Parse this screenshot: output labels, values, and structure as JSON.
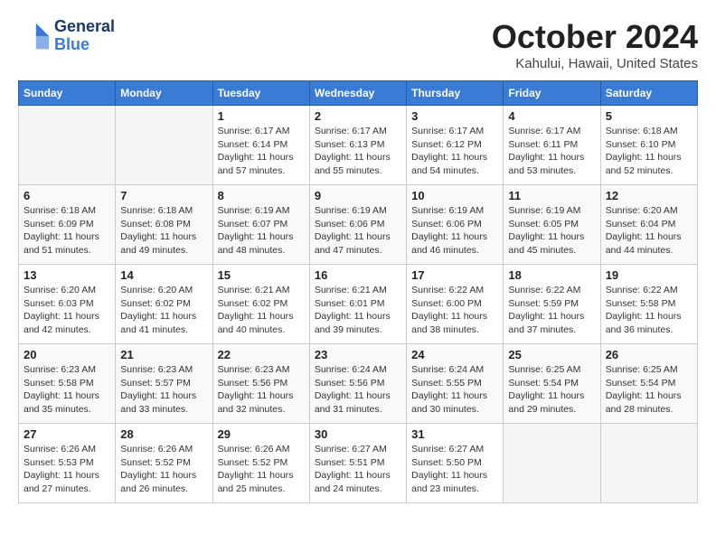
{
  "header": {
    "logo_line1": "General",
    "logo_line2": "Blue",
    "month": "October 2024",
    "location": "Kahului, Hawaii, United States"
  },
  "days_of_week": [
    "Sunday",
    "Monday",
    "Tuesday",
    "Wednesday",
    "Thursday",
    "Friday",
    "Saturday"
  ],
  "weeks": [
    [
      {
        "day": "",
        "sunrise": "",
        "sunset": "",
        "daylight": ""
      },
      {
        "day": "",
        "sunrise": "",
        "sunset": "",
        "daylight": ""
      },
      {
        "day": "1",
        "sunrise": "Sunrise: 6:17 AM",
        "sunset": "Sunset: 6:14 PM",
        "daylight": "Daylight: 11 hours and 57 minutes."
      },
      {
        "day": "2",
        "sunrise": "Sunrise: 6:17 AM",
        "sunset": "Sunset: 6:13 PM",
        "daylight": "Daylight: 11 hours and 55 minutes."
      },
      {
        "day": "3",
        "sunrise": "Sunrise: 6:17 AM",
        "sunset": "Sunset: 6:12 PM",
        "daylight": "Daylight: 11 hours and 54 minutes."
      },
      {
        "day": "4",
        "sunrise": "Sunrise: 6:17 AM",
        "sunset": "Sunset: 6:11 PM",
        "daylight": "Daylight: 11 hours and 53 minutes."
      },
      {
        "day": "5",
        "sunrise": "Sunrise: 6:18 AM",
        "sunset": "Sunset: 6:10 PM",
        "daylight": "Daylight: 11 hours and 52 minutes."
      }
    ],
    [
      {
        "day": "6",
        "sunrise": "Sunrise: 6:18 AM",
        "sunset": "Sunset: 6:09 PM",
        "daylight": "Daylight: 11 hours and 51 minutes."
      },
      {
        "day": "7",
        "sunrise": "Sunrise: 6:18 AM",
        "sunset": "Sunset: 6:08 PM",
        "daylight": "Daylight: 11 hours and 49 minutes."
      },
      {
        "day": "8",
        "sunrise": "Sunrise: 6:19 AM",
        "sunset": "Sunset: 6:07 PM",
        "daylight": "Daylight: 11 hours and 48 minutes."
      },
      {
        "day": "9",
        "sunrise": "Sunrise: 6:19 AM",
        "sunset": "Sunset: 6:06 PM",
        "daylight": "Daylight: 11 hours and 47 minutes."
      },
      {
        "day": "10",
        "sunrise": "Sunrise: 6:19 AM",
        "sunset": "Sunset: 6:06 PM",
        "daylight": "Daylight: 11 hours and 46 minutes."
      },
      {
        "day": "11",
        "sunrise": "Sunrise: 6:19 AM",
        "sunset": "Sunset: 6:05 PM",
        "daylight": "Daylight: 11 hours and 45 minutes."
      },
      {
        "day": "12",
        "sunrise": "Sunrise: 6:20 AM",
        "sunset": "Sunset: 6:04 PM",
        "daylight": "Daylight: 11 hours and 44 minutes."
      }
    ],
    [
      {
        "day": "13",
        "sunrise": "Sunrise: 6:20 AM",
        "sunset": "Sunset: 6:03 PM",
        "daylight": "Daylight: 11 hours and 42 minutes."
      },
      {
        "day": "14",
        "sunrise": "Sunrise: 6:20 AM",
        "sunset": "Sunset: 6:02 PM",
        "daylight": "Daylight: 11 hours and 41 minutes."
      },
      {
        "day": "15",
        "sunrise": "Sunrise: 6:21 AM",
        "sunset": "Sunset: 6:02 PM",
        "daylight": "Daylight: 11 hours and 40 minutes."
      },
      {
        "day": "16",
        "sunrise": "Sunrise: 6:21 AM",
        "sunset": "Sunset: 6:01 PM",
        "daylight": "Daylight: 11 hours and 39 minutes."
      },
      {
        "day": "17",
        "sunrise": "Sunrise: 6:22 AM",
        "sunset": "Sunset: 6:00 PM",
        "daylight": "Daylight: 11 hours and 38 minutes."
      },
      {
        "day": "18",
        "sunrise": "Sunrise: 6:22 AM",
        "sunset": "Sunset: 5:59 PM",
        "daylight": "Daylight: 11 hours and 37 minutes."
      },
      {
        "day": "19",
        "sunrise": "Sunrise: 6:22 AM",
        "sunset": "Sunset: 5:58 PM",
        "daylight": "Daylight: 11 hours and 36 minutes."
      }
    ],
    [
      {
        "day": "20",
        "sunrise": "Sunrise: 6:23 AM",
        "sunset": "Sunset: 5:58 PM",
        "daylight": "Daylight: 11 hours and 35 minutes."
      },
      {
        "day": "21",
        "sunrise": "Sunrise: 6:23 AM",
        "sunset": "Sunset: 5:57 PM",
        "daylight": "Daylight: 11 hours and 33 minutes."
      },
      {
        "day": "22",
        "sunrise": "Sunrise: 6:23 AM",
        "sunset": "Sunset: 5:56 PM",
        "daylight": "Daylight: 11 hours and 32 minutes."
      },
      {
        "day": "23",
        "sunrise": "Sunrise: 6:24 AM",
        "sunset": "Sunset: 5:56 PM",
        "daylight": "Daylight: 11 hours and 31 minutes."
      },
      {
        "day": "24",
        "sunrise": "Sunrise: 6:24 AM",
        "sunset": "Sunset: 5:55 PM",
        "daylight": "Daylight: 11 hours and 30 minutes."
      },
      {
        "day": "25",
        "sunrise": "Sunrise: 6:25 AM",
        "sunset": "Sunset: 5:54 PM",
        "daylight": "Daylight: 11 hours and 29 minutes."
      },
      {
        "day": "26",
        "sunrise": "Sunrise: 6:25 AM",
        "sunset": "Sunset: 5:54 PM",
        "daylight": "Daylight: 11 hours and 28 minutes."
      }
    ],
    [
      {
        "day": "27",
        "sunrise": "Sunrise: 6:26 AM",
        "sunset": "Sunset: 5:53 PM",
        "daylight": "Daylight: 11 hours and 27 minutes."
      },
      {
        "day": "28",
        "sunrise": "Sunrise: 6:26 AM",
        "sunset": "Sunset: 5:52 PM",
        "daylight": "Daylight: 11 hours and 26 minutes."
      },
      {
        "day": "29",
        "sunrise": "Sunrise: 6:26 AM",
        "sunset": "Sunset: 5:52 PM",
        "daylight": "Daylight: 11 hours and 25 minutes."
      },
      {
        "day": "30",
        "sunrise": "Sunrise: 6:27 AM",
        "sunset": "Sunset: 5:51 PM",
        "daylight": "Daylight: 11 hours and 24 minutes."
      },
      {
        "day": "31",
        "sunrise": "Sunrise: 6:27 AM",
        "sunset": "Sunset: 5:50 PM",
        "daylight": "Daylight: 11 hours and 23 minutes."
      },
      {
        "day": "",
        "sunrise": "",
        "sunset": "",
        "daylight": ""
      },
      {
        "day": "",
        "sunrise": "",
        "sunset": "",
        "daylight": ""
      }
    ]
  ]
}
